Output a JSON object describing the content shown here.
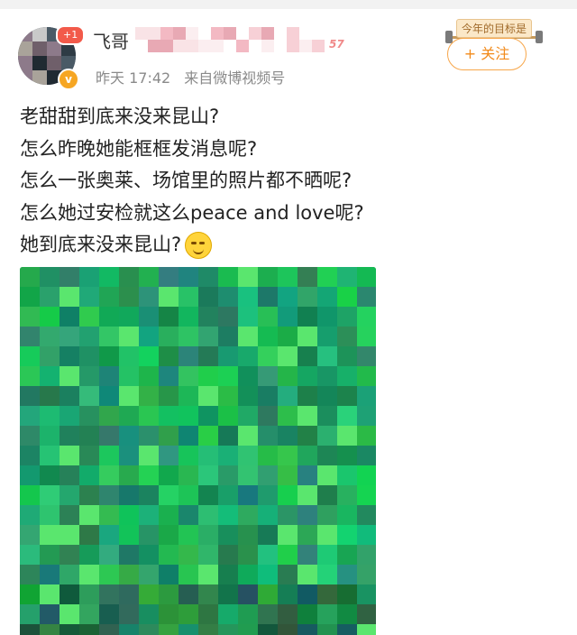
{
  "post": {
    "avatar_badge": "+1",
    "verified_badge": "v",
    "username": "飞哥",
    "level_badge": "57",
    "time": "昨天 17:42",
    "source": "来自微博视频号",
    "goal_badge": "今年的目标是",
    "follow_label": "+ 关注",
    "lines": [
      "老甜甜到底来没来昆山?",
      "怎么昨晚她能框框发消息呢?",
      "怎么一张奥莱、场馆里的照片都不晒呢?",
      "怎么她过安检就这么peace and love呢?",
      "她到底来没来昆山?"
    ],
    "emoji_name": "grin-sweat-emoji"
  }
}
